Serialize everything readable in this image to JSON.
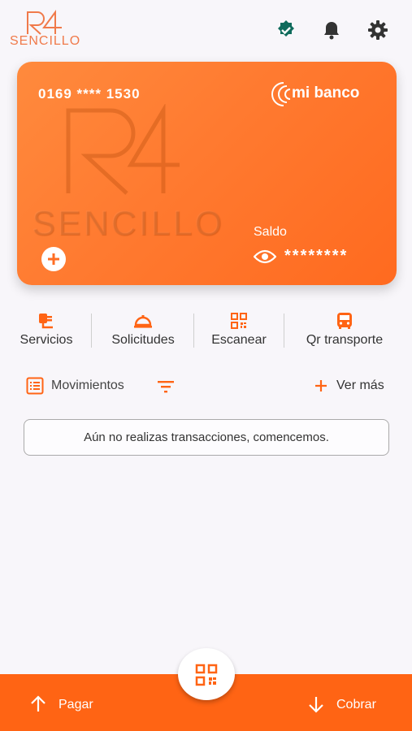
{
  "brand": {
    "logo_text": "SENCILLO",
    "accent": "#ff6414"
  },
  "card": {
    "number": "0169 **** 1530",
    "bank_name": "mi banco",
    "watermark_text": "SENCILLO",
    "saldo_label": "Saldo",
    "saldo_value": "********"
  },
  "actions": [
    {
      "label": "Servicios",
      "icon": "plug-icon"
    },
    {
      "label": "Solicitudes",
      "icon": "service-bell-icon"
    },
    {
      "label": "Escanear",
      "icon": "qr-scan-icon"
    },
    {
      "label": "Qr transporte",
      "icon": "bus-icon"
    }
  ],
  "movimientos": {
    "label": "Movimientos",
    "ver_mas": "Ver más"
  },
  "empty_message": "Aún no realizas transacciones, comencemos.",
  "bottom": {
    "pagar": "Pagar",
    "cobrar": "Cobrar"
  }
}
